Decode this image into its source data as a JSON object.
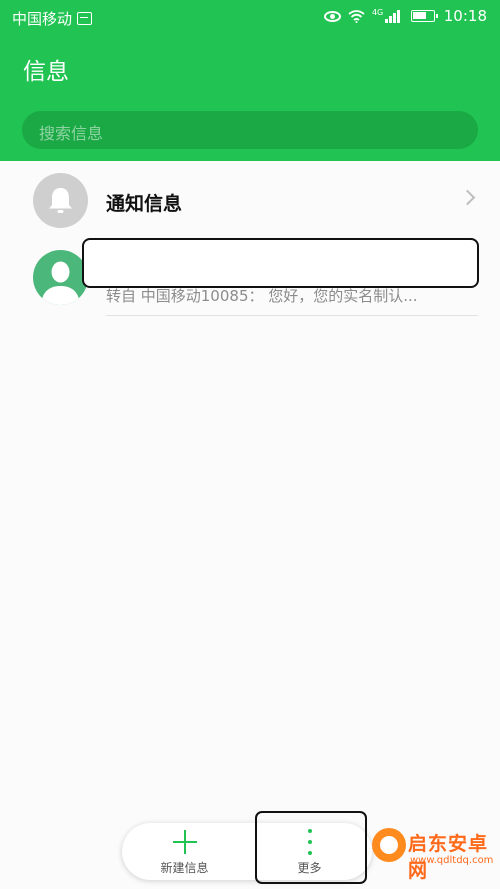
{
  "status_bar": {
    "carrier": "中国移动",
    "network": "4G",
    "time": "10:18"
  },
  "header": {
    "title": "信息",
    "search_placeholder": "搜索信息"
  },
  "conversations": [
    {
      "title": "通知信息",
      "icon": "bell-icon"
    },
    {
      "title": "",
      "preview": "转自 中国移动10085： 您好，您的实名制认...",
      "icon": "person-icon"
    }
  ],
  "bottom_bar": {
    "new_message_label": "新建信息",
    "more_label": "更多"
  },
  "watermark": {
    "title": "启东安卓网",
    "url": "www.qdltdq.com"
  },
  "colors": {
    "accent": "#21c452",
    "search_bg": "#1aa944",
    "avatar_green": "#4bb77a",
    "avatar_gray": "#cfcfcf"
  }
}
